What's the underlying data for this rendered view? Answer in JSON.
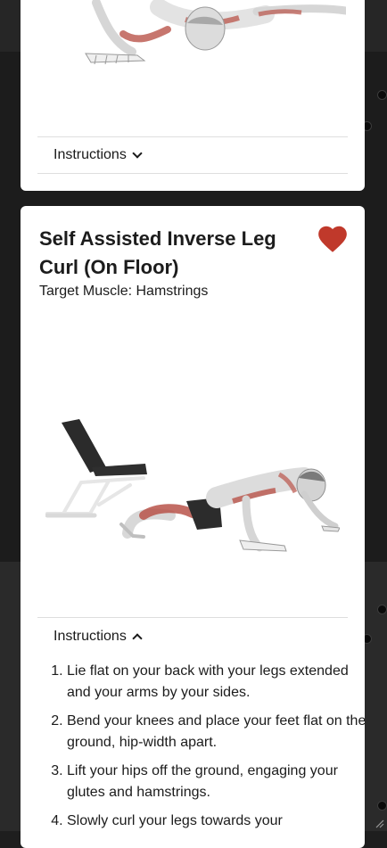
{
  "cards": [
    {
      "instructions_label": "Instructions"
    },
    {
      "title": "Self Assisted Inverse Leg Curl (On Floor)",
      "target_label": "Target Muscle: Hamstrings",
      "favorited": true,
      "instructions_label": "Instructions",
      "instructions_expanded": true,
      "steps": [
        "Lie flat on your back with your legs extended and your arms by your sides.",
        "Bend your knees and place your feet flat on the ground, hip-width apart.",
        "Lift your hips off the ground, engaging your glutes and hamstrings.",
        "Slowly curl your legs towards your"
      ]
    }
  ],
  "colors": {
    "heart": "#c0392b",
    "muscle": "#b9544a",
    "card_bg": "#ffffff"
  },
  "icons": {
    "favorite": "heart-icon",
    "collapsed": "chevron-down-icon",
    "expanded": "chevron-up-icon"
  }
}
